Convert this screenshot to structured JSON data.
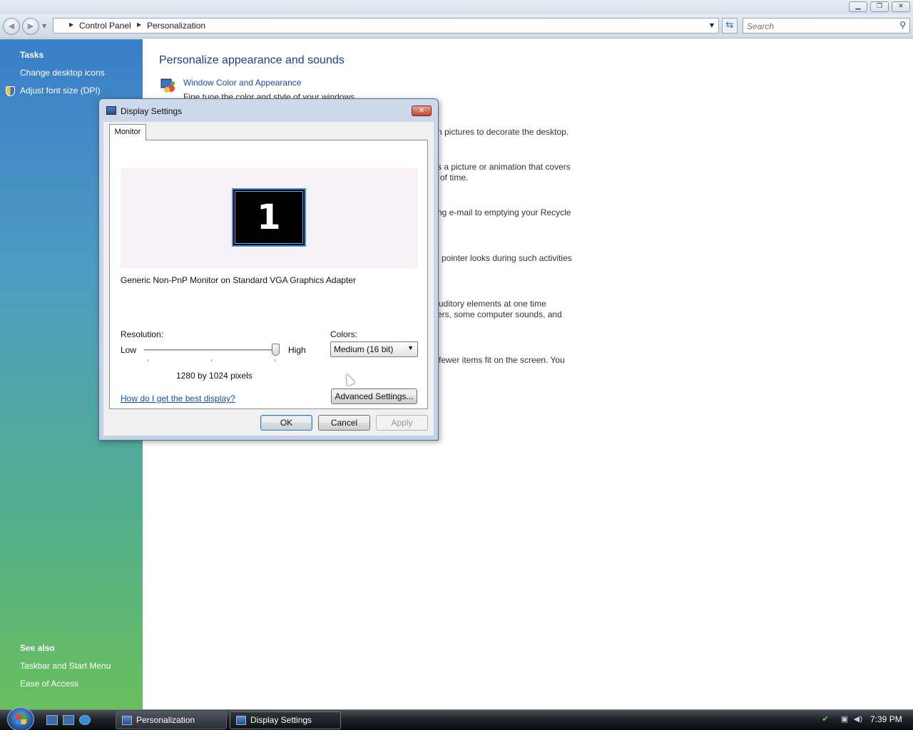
{
  "explorer": {
    "breadcrumb": [
      "Control Panel",
      "Personalization"
    ],
    "search_placeholder": "Search"
  },
  "taskpane": {
    "tasks_heading": "Tasks",
    "tasks": [
      "Change desktop icons",
      "Adjust font size (DPI)"
    ],
    "see_also_heading": "See also",
    "see_also": [
      "Taskbar and Start Menu",
      "Ease of Access"
    ]
  },
  "main": {
    "title": "Personalize appearance and sounds",
    "first_item_link": "Window Color and Appearance",
    "first_item_desc": "Fine tune the color and style of your windows.",
    "fragments": [
      "n pictures to decorate the desktop.",
      "s a picture or animation that covers",
      "of time.",
      "ng e-mail to emptying your Recycle",
      "pointer looks during such activities",
      "uditory elements at one time",
      "ers, some computer sounds, and",
      "fewer items fit on the screen. You"
    ]
  },
  "dialog": {
    "title": "Display Settings",
    "tab": "Monitor",
    "monitor_number": "1",
    "monitor_desc": "Generic Non-PnP Monitor on Standard VGA Graphics Adapter",
    "resolution_label": "Resolution:",
    "low_label": "Low",
    "high_label": "High",
    "resolution_value": "1280 by 1024 pixels",
    "resolution_slider_level": 1.0,
    "colors_label": "Colors:",
    "colors_value": "Medium (16 bit)",
    "help_link": "How do I get the best display?",
    "advanced_button": "Advanced Settings...",
    "ok_button": "OK",
    "cancel_button": "Cancel",
    "apply_button": "Apply"
  },
  "taskbar": {
    "buttons": [
      "Personalization",
      "Display Settings"
    ],
    "clock": "7:39 PM"
  },
  "colors": {
    "link_blue": "#1a4cb0",
    "title_blue": "#1b3f8e",
    "monitor_highlight": "#3c8ee4"
  }
}
